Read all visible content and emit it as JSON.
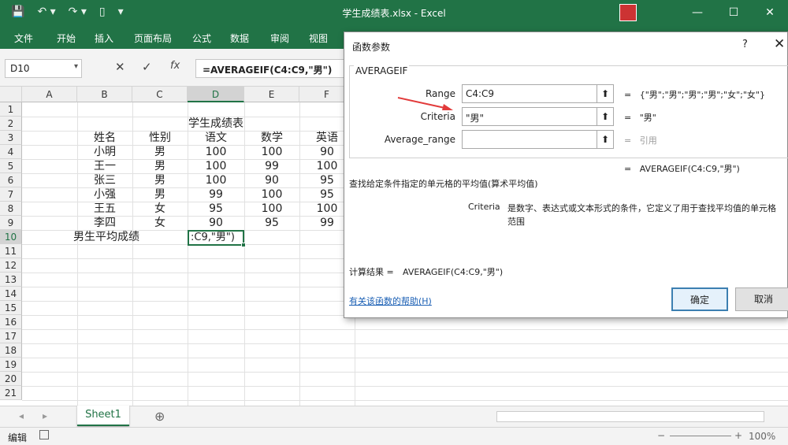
{
  "window": {
    "title": "学生成绩表.xlsx  -  Excel",
    "min": "—",
    "max": "☐",
    "close": "✕"
  },
  "qat": {
    "save": "💾",
    "undo": "↶ ▾",
    "redo": "↷ ▾",
    "new": "▯",
    "more": "▾"
  },
  "ribbon": {
    "tabs": [
      "文件",
      "开始",
      "插入",
      "页面布局",
      "公式",
      "数据",
      "审阅",
      "视图"
    ]
  },
  "formula_bar": {
    "name_box": "D10",
    "name_dd": "▾",
    "cancel": "✕",
    "enter": "✓",
    "fx": "fx",
    "formula": "=AVERAGEIF(C4:C9,\"男\")"
  },
  "grid": {
    "columns": [
      "A",
      "B",
      "C",
      "D",
      "E",
      "F"
    ],
    "rows": [
      "1",
      "2",
      "3",
      "4",
      "5",
      "6",
      "7",
      "8",
      "9",
      "10",
      "11",
      "12",
      "13",
      "14",
      "15",
      "16",
      "17",
      "18",
      "19",
      "20",
      "21"
    ],
    "title": "学生成绩表",
    "headers": [
      "姓名",
      "性别",
      "语文",
      "数学",
      "英语"
    ],
    "data": [
      [
        "小明",
        "男",
        "100",
        "100",
        "90"
      ],
      [
        "王一",
        "男",
        "100",
        "99",
        "100"
      ],
      [
        "张三",
        "男",
        "100",
        "90",
        "95"
      ],
      [
        "小强",
        "男",
        "99",
        "100",
        "95"
      ],
      [
        "王五",
        "女",
        "95",
        "100",
        "100"
      ],
      [
        "李四",
        "女",
        "90",
        "95",
        "99"
      ]
    ],
    "label_row10": "男生平均成绩",
    "active_cell_text": ":C9,\"男\")"
  },
  "sheet_tabs": {
    "active": "Sheet1",
    "add": "⊕",
    "nav_prev": "◂",
    "nav_next": "▸"
  },
  "status": {
    "mode": "编辑",
    "zoom": "100%",
    "minus": "−",
    "plus": "+"
  },
  "dialog": {
    "title": "函数参数",
    "help": "?",
    "close": "✕",
    "function_name": "AVERAGEIF",
    "args": [
      {
        "label": "Range",
        "value": "C4:C9",
        "result": "{\"男\";\"男\";\"男\";\"男\";\"女\";\"女\"}"
      },
      {
        "label": "Criteria",
        "value": "\"男\"",
        "result": "\"男\""
      },
      {
        "label": "Average_range",
        "value": "",
        "result": "引用"
      }
    ],
    "eq": "=",
    "formula_result": "AVERAGEIF(C4:C9,\"男\")",
    "description": "查找给定条件指定的单元格的平均值(算术平均值)",
    "arg_name": "Criteria",
    "arg_desc_line1": "是数字、表达式或文本形式的条件，它定义了用于查找平均值的单元格",
    "arg_desc_line2": "范围",
    "result_label": "计算结果 =",
    "result_value": "AVERAGEIF(C4:C9,\"男\")",
    "help_link": "有关该函数的帮助(H)",
    "ok": "确定",
    "cancel": "取消"
  }
}
